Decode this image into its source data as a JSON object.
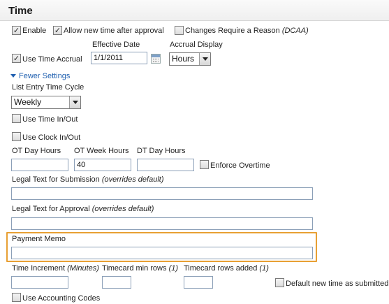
{
  "header": {
    "title": "Time"
  },
  "row1": {
    "enable": {
      "label": "Enable",
      "checked": true
    },
    "allow_after_approval": {
      "label": "Allow new time after approval",
      "checked": true
    },
    "require_reason": {
      "label": "Changes Require a Reason",
      "label_suffix": "(DCAA)",
      "checked": false
    }
  },
  "accrual": {
    "use_time_accrual": {
      "label": "Use Time Accrual",
      "checked": true
    },
    "effective_date_label": "Effective Date",
    "effective_date_value": "1/1/2011",
    "display_label": "Accrual Display",
    "display_value": "Hours"
  },
  "fewer_settings_link": "Fewer Settings",
  "cycle": {
    "label": "List Entry Time Cycle",
    "value": "Weekly"
  },
  "use_time_in_out": {
    "label": "Use Time In/Out",
    "checked": false
  },
  "use_clock_in_out": {
    "label": "Use Clock In/Out",
    "checked": false
  },
  "ot": {
    "day_label": "OT Day Hours",
    "day_value": "",
    "week_label": "OT Week Hours",
    "week_value": "40",
    "dt_label": "DT Day Hours",
    "dt_value": "",
    "enforce": {
      "label": "Enforce Overtime",
      "checked": false
    }
  },
  "legal_submission": {
    "label": "Legal Text for Submission",
    "label_suffix": "(overrides default)",
    "value": ""
  },
  "legal_approval": {
    "label": "Legal Text for Approval",
    "label_suffix": "(overrides default)",
    "value": ""
  },
  "payment_memo": {
    "label": "Payment Memo",
    "value": ""
  },
  "increments": {
    "time_increment_label": "Time Increment",
    "time_increment_suffix": "(Minutes)",
    "time_increment_value": "",
    "min_rows_label": "Timecard min rows",
    "min_rows_suffix": "(1)",
    "min_rows_value": "",
    "rows_added_label": "Timecard rows added",
    "rows_added_suffix": "(1)",
    "rows_added_value": "",
    "default_submitted": {
      "label": "Default new time as submitted",
      "checked": false
    }
  },
  "use_accounting_codes": {
    "label": "Use Accounting Codes",
    "checked": false
  },
  "colors": {
    "highlight": "#e8a034",
    "link": "#2060b0"
  }
}
